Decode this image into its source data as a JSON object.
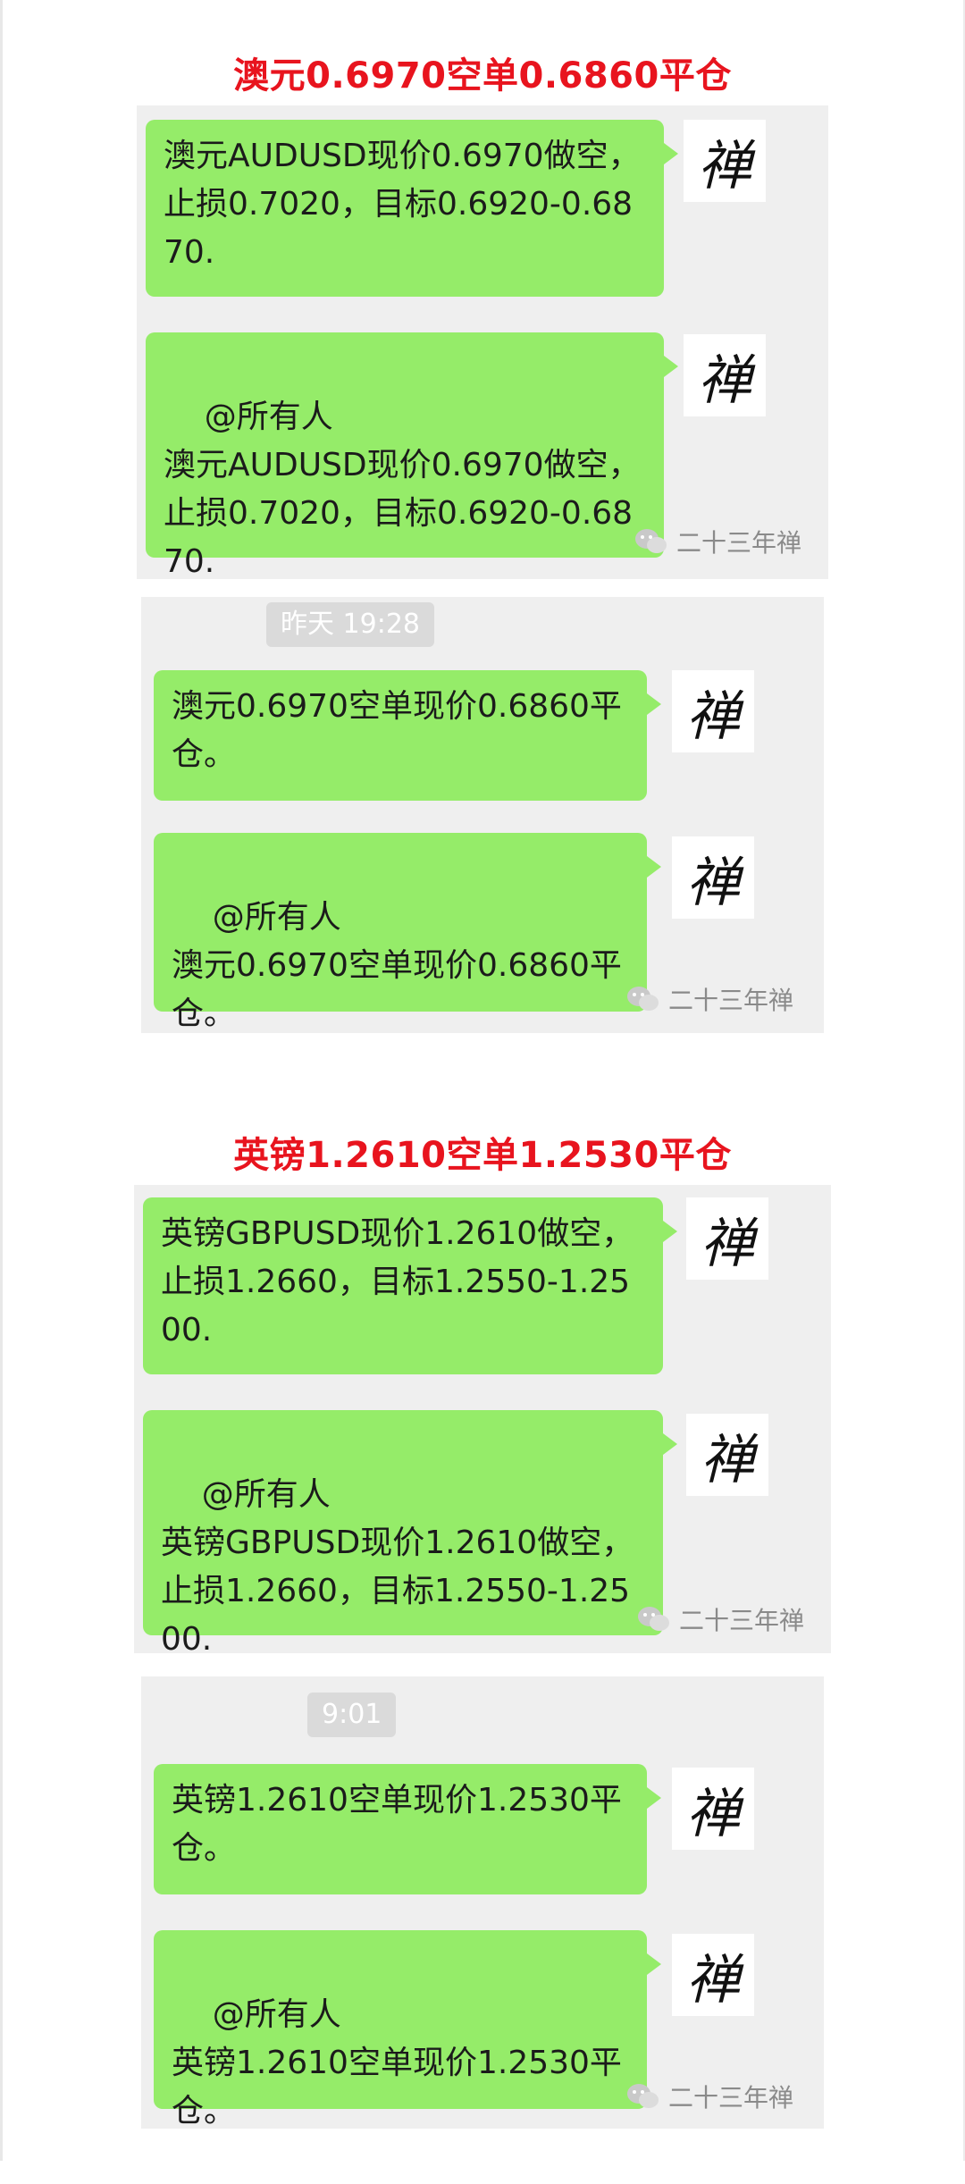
{
  "sections": [
    {
      "title": "澳元0.6970空单0.6860平仓",
      "screens": [
        {
          "timestamp": "",
          "messages": [
            {
              "text": "澳元AUDUSD现价0.6970做空，止损0.7020，目标0.6920-0.6870.",
              "avatar": "禅"
            },
            {
              "text": "@所有人\n澳元AUDUSD现价0.6970做空，止损0.7020，目标0.6920-0.6870.",
              "avatar": "禅"
            }
          ],
          "watermark": "二十三年禅"
        },
        {
          "timestamp": "昨天 19:28",
          "messages": [
            {
              "text": "澳元0.6970空单现价0.6860平仓。",
              "avatar": "禅"
            },
            {
              "text": "@所有人\n澳元0.6970空单现价0.6860平仓。",
              "avatar": "禅"
            }
          ],
          "watermark": "二十三年禅"
        }
      ]
    },
    {
      "title": "英镑1.2610空单1.2530平仓",
      "screens": [
        {
          "timestamp": "",
          "messages": [
            {
              "text": "英镑GBPUSD现价1.2610做空，止损1.2660，目标1.2550-1.2500.",
              "avatar": "禅"
            },
            {
              "text": "@所有人\n英镑GBPUSD现价1.2610做空，止损1.2660，目标1.2550-1.2500.",
              "avatar": "禅"
            }
          ],
          "watermark": "二十三年禅"
        },
        {
          "timestamp": "9:01",
          "messages": [
            {
              "text": "英镑1.2610空单现价1.2530平仓。",
              "avatar": "禅"
            },
            {
              "text": "@所有人\n英镑1.2610空单现价1.2530平仓。",
              "avatar": "禅"
            }
          ],
          "watermark": "二十三年禅"
        }
      ]
    }
  ],
  "colors": {
    "title": "#e8141e",
    "bubble": "#95ec69",
    "panel": "#efefef"
  },
  "icons": {
    "avatar": "calligraphy-avatar",
    "watermark": "wechat-icon"
  }
}
